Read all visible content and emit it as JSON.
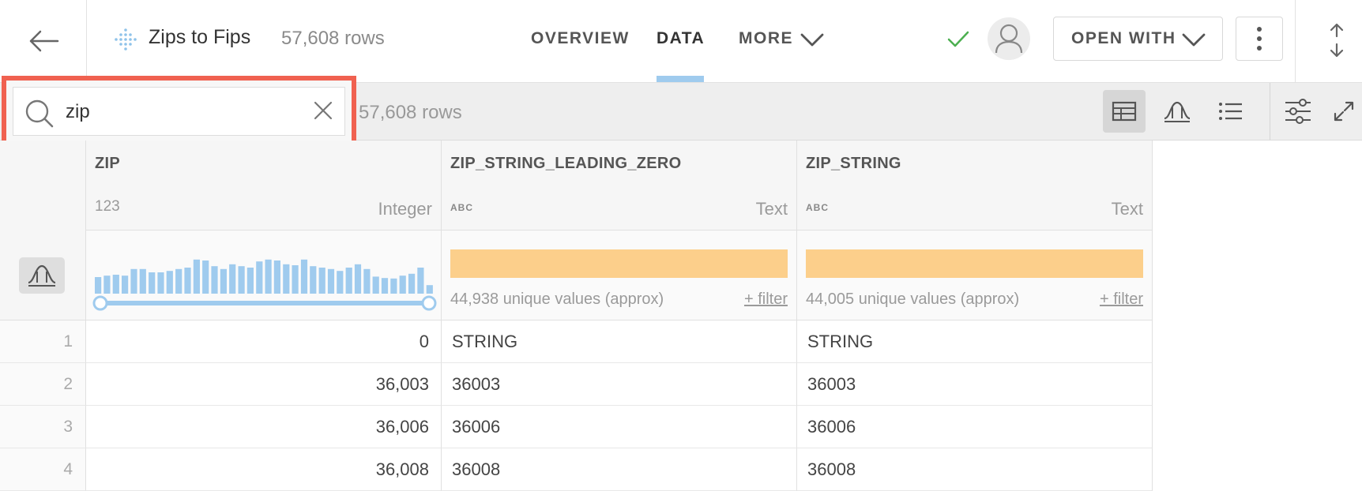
{
  "header": {
    "dataset_title": "Zips to Fips",
    "row_count": "57,608 rows",
    "tabs": [
      {
        "label": "OVERVIEW",
        "active": false
      },
      {
        "label": "DATA",
        "active": true
      },
      {
        "label": "MORE",
        "active": false
      }
    ],
    "open_with_label": "OPEN WITH",
    "status": "check-icon",
    "accent_color": "#9fcbee"
  },
  "toolbar": {
    "search": {
      "value": "zip",
      "highlight_color": "#f06150"
    },
    "row_count": "57,608 rows",
    "views": [
      {
        "icon": "table-icon",
        "active": true
      },
      {
        "icon": "distribution-icon",
        "active": false
      },
      {
        "icon": "list-icon",
        "active": false
      }
    ],
    "settings_icon": "sliders-icon",
    "expand_icon": "expand-icon"
  },
  "columns": [
    {
      "name": "ZIP",
      "type_icon": "123",
      "type": "Integer",
      "histogram": [
        0.35,
        0.38,
        0.4,
        0.38,
        0.52,
        0.52,
        0.45,
        0.45,
        0.48,
        0.52,
        0.55,
        0.72,
        0.7,
        0.58,
        0.52,
        0.62,
        0.58,
        0.55,
        0.68,
        0.72,
        0.7,
        0.62,
        0.6,
        0.72,
        0.58,
        0.55,
        0.52,
        0.48,
        0.55,
        0.62,
        0.52,
        0.36,
        0.33,
        0.32,
        0.38,
        0.42,
        0.55,
        0.18
      ],
      "histogram_color": "#9fcbee"
    },
    {
      "name": "ZIP_STRING_LEADING_ZERO",
      "type_icon": "ABC",
      "type": "Text",
      "unique_text": "44,938 unique values (approx)",
      "filter_label": "+ filter",
      "bar_color": "#fccf8b"
    },
    {
      "name": "ZIP_STRING",
      "type_icon": "ABC",
      "type": "Text",
      "unique_text": "44,005 unique values (approx)",
      "filter_label": "+ filter",
      "bar_color": "#fccf8b"
    }
  ],
  "rows": [
    {
      "num": "1",
      "zip": "0",
      "zip_leading": "STRING",
      "zip_string": "STRING"
    },
    {
      "num": "2",
      "zip": "36,003",
      "zip_leading": "36003",
      "zip_string": "36003"
    },
    {
      "num": "3",
      "zip": "36,006",
      "zip_leading": "36006",
      "zip_string": "36006"
    },
    {
      "num": "4",
      "zip": "36,008",
      "zip_leading": "36008",
      "zip_string": "36008"
    }
  ]
}
